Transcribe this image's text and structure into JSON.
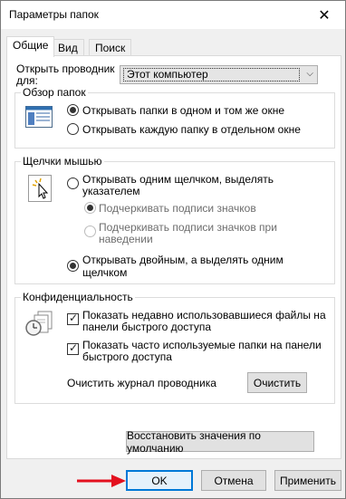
{
  "window": {
    "title": "Параметры папок",
    "close_glyph": "✕"
  },
  "tabs": [
    {
      "label": "Общие",
      "active": true
    },
    {
      "label": "Вид",
      "active": false
    },
    {
      "label": "Поиск",
      "active": false
    }
  ],
  "open_explorer": {
    "label_line1": "Открыть проводник",
    "label_line2": "для:",
    "selected": "Этот компьютер",
    "arrow_glyph": "⌵"
  },
  "browse_group": {
    "title": "Обзор папок",
    "icon": "window-icon",
    "options": [
      {
        "label": "Открывать папки в одном и том же окне",
        "checked": true
      },
      {
        "label": "Открывать каждую папку в отдельном окне",
        "checked": false
      }
    ]
  },
  "click_group": {
    "title": "Щелчки мышью",
    "icon": "mouse-click-icon",
    "single_click": {
      "line1": "Открывать одним щелчком, выделять",
      "line2": "указателем",
      "checked": false
    },
    "sub_underline_always": {
      "label": "Подчеркивать подписи значков",
      "checked": true
    },
    "sub_underline_hover": {
      "line1": "Подчеркивать подписи значков при",
      "line2": "наведении",
      "checked": false
    },
    "double_click": {
      "line1": "Открывать двойным, а выделять одним",
      "line2": "щелчком",
      "checked": true
    }
  },
  "privacy_group": {
    "title": "Конфиденциальность",
    "icon": "clock-documents-icon",
    "recent_files": {
      "line1": "Показать недавно использовавшиеся файлы на",
      "line2": "панели быстрого доступа",
      "checked": true
    },
    "frequent_folders": {
      "line1": "Показать часто используемые папки на панели",
      "line2": "быстрого доступа",
      "checked": true
    },
    "clear_history_label": "Очистить журнал проводника",
    "clear_button": "Очистить"
  },
  "restore_defaults_button": "Восстановить значения по умолчанию",
  "footer": {
    "ok": "OK",
    "cancel": "Отмена",
    "apply": "Применить"
  },
  "colors": {
    "accent": "#0078d7",
    "arrow": "#e3101e"
  }
}
